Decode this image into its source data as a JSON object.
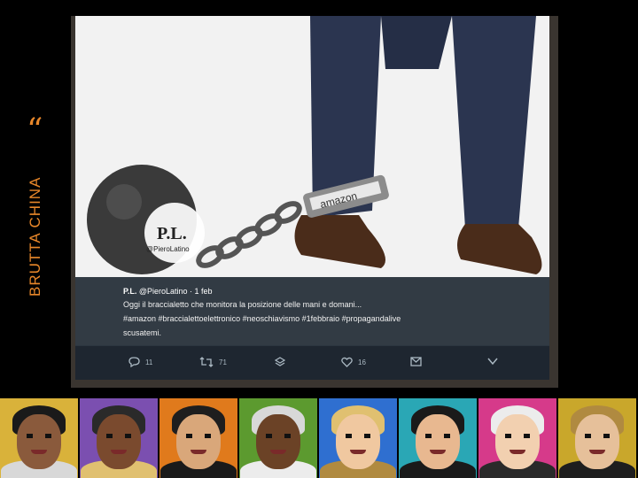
{
  "slide": {
    "vertical_title": "BRUTTA CHINA",
    "quote_mark": "“",
    "accent_color": "#e8872a"
  },
  "image": {
    "description_icon": "ball-and-chain-image",
    "brand_on_cuff": "amazon",
    "stamp_main": "P.L.",
    "stamp_handle": "@PieroLatino"
  },
  "tweet": {
    "author": "P.L.",
    "handle": "@PieroLatino",
    "time": "· 1 feb",
    "line1": "Oggi il braccialetto che monitora la posizione delle mani e domani...",
    "line2": "#amazon #braccialettoelettronico #neoschiavismo #1febbraio #propagandalive",
    "line3": "scusatemi.",
    "actions": {
      "reply_count": "11",
      "retweet_count": "71",
      "like_count": "16"
    }
  },
  "portrait_strip": {
    "panel_colors": [
      "#d9b23a",
      "#7b4fb0",
      "#e07a1c",
      "#5c9a2f",
      "#2f6fd0",
      "#2aa7b5",
      "#d63a8a",
      "#c9a72b"
    ]
  }
}
